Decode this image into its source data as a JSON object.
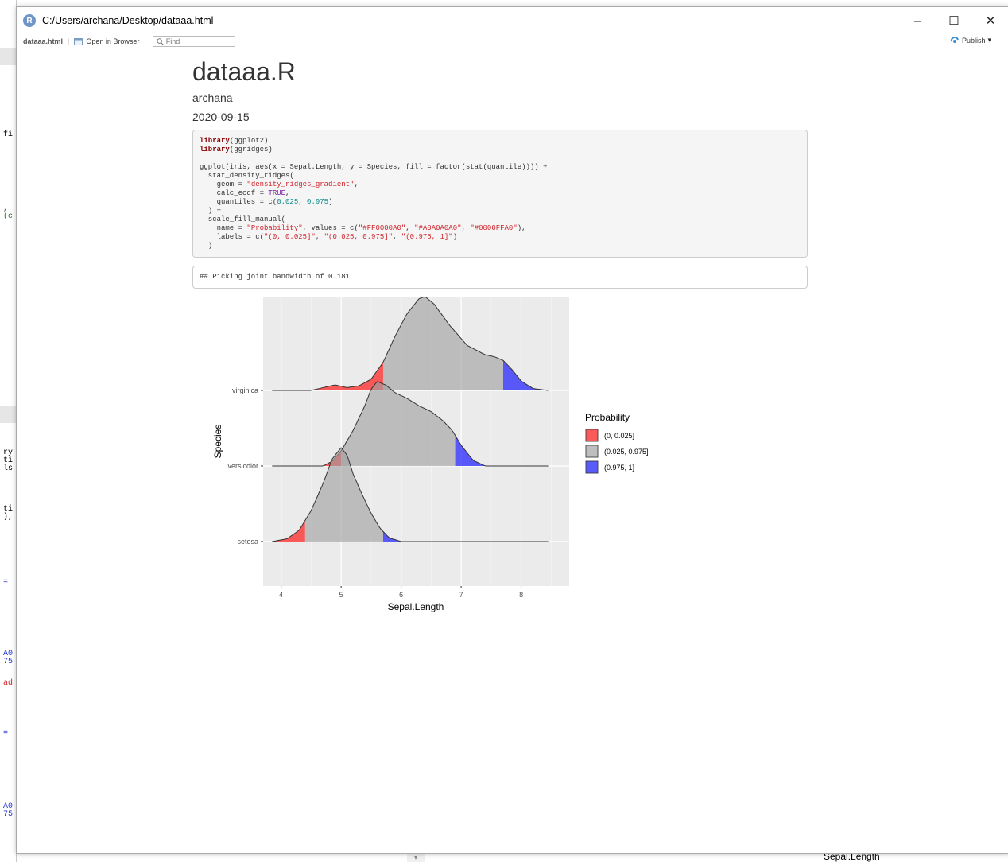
{
  "window": {
    "title": "C:/Users/archana/Desktop/dataaa.html",
    "app_icon_letter": "R",
    "minimize": "–",
    "maximize": "☐",
    "close": "✕"
  },
  "toolbar": {
    "file_name": "dataaa.html",
    "open_in_browser": "Open in Browser",
    "find_placeholder": "Find",
    "publish": "Publish",
    "publish_caret": "▾"
  },
  "document": {
    "title": "dataaa.R",
    "author": "archana",
    "date": "2020-09-15",
    "output": "## Picking joint bandwidth of 0.181"
  },
  "background_fragments": {
    "f1": "fi",
    "f2": ",\n(c",
    "f3": "ry\nti\nls",
    "f4": "ti\n),",
    "f5": "=",
    "f6": "A0\n75",
    "f7": "ad",
    "f8": "=",
    "f9": "A0\n75",
    "bottom_label": "Sepal.Length",
    "scroll_down": "▾"
  },
  "chart_data": {
    "type": "ridgeline",
    "title": "",
    "xlabel": "Sepal.Length",
    "ylabel": "Species",
    "xlim": [
      3.7,
      8.8
    ],
    "x_ticks": [
      "4",
      "5",
      "6",
      "7",
      "8"
    ],
    "categories": [
      "setosa",
      "versicolor",
      "virginica"
    ],
    "legend": {
      "title": "Probability",
      "position": "right",
      "entries": [
        {
          "label": "(0, 0.025]",
          "color": "#FF0000A0"
        },
        {
          "label": "(0.025, 0.975]",
          "color": "#A0A0A0A0"
        },
        {
          "label": "(0.975, 1]",
          "color": "#0000FFA0"
        }
      ]
    },
    "series": [
      {
        "name": "setosa",
        "quantiles": [
          4.4,
          5.7
        ],
        "x": [
          3.85,
          4.1,
          4.3,
          4.5,
          4.7,
          4.85,
          5.0,
          5.1,
          5.2,
          5.35,
          5.5,
          5.65,
          5.8,
          6.0,
          8.45
        ],
        "density": [
          0.0,
          0.03,
          0.12,
          0.33,
          0.62,
          0.88,
          1.0,
          0.92,
          0.72,
          0.5,
          0.3,
          0.14,
          0.04,
          0.0,
          0.0
        ]
      },
      {
        "name": "versicolor",
        "quantiles": [
          5.0,
          6.9
        ],
        "x": [
          3.85,
          4.7,
          4.85,
          5.0,
          5.2,
          5.4,
          5.5,
          5.6,
          5.75,
          5.9,
          6.1,
          6.3,
          6.5,
          6.7,
          6.85,
          7.0,
          7.2,
          7.4,
          8.45
        ],
        "density": [
          0.0,
          0.0,
          0.05,
          0.16,
          0.38,
          0.65,
          0.82,
          0.9,
          0.86,
          0.78,
          0.72,
          0.64,
          0.58,
          0.48,
          0.38,
          0.22,
          0.06,
          0.0,
          0.0
        ]
      },
      {
        "name": "virginica",
        "quantiles": [
          5.7,
          7.7
        ],
        "x": [
          3.85,
          4.5,
          4.7,
          4.9,
          5.1,
          5.3,
          5.5,
          5.7,
          5.9,
          6.1,
          6.3,
          6.4,
          6.55,
          6.8,
          7.1,
          7.4,
          7.55,
          7.7,
          7.85,
          8.0,
          8.2,
          8.45
        ],
        "density": [
          0.0,
          0.0,
          0.03,
          0.06,
          0.03,
          0.05,
          0.12,
          0.3,
          0.58,
          0.82,
          0.98,
          1.0,
          0.92,
          0.7,
          0.48,
          0.38,
          0.36,
          0.32,
          0.22,
          0.1,
          0.02,
          0.0
        ]
      }
    ]
  }
}
